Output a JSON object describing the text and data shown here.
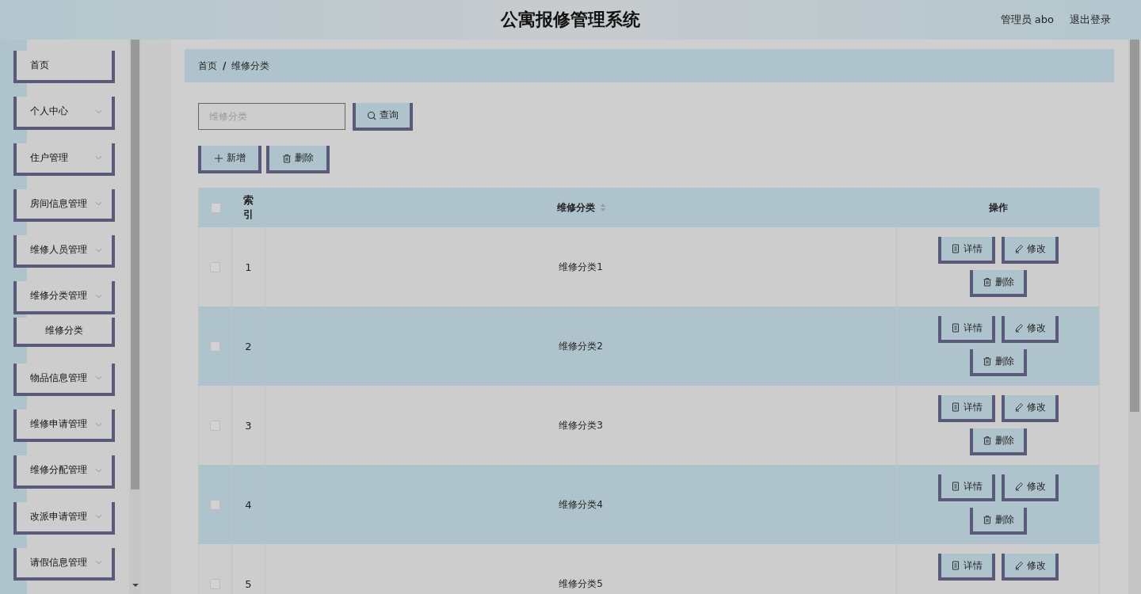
{
  "header": {
    "title": "公寓报修管理系统",
    "user": "管理员 abo",
    "logout": "退出登录"
  },
  "sidebar": {
    "items": [
      {
        "label": "首页",
        "kind": "link"
      },
      {
        "label": "个人中心",
        "kind": "group",
        "expanded": false
      },
      {
        "label": "住户管理",
        "kind": "group",
        "expanded": false
      },
      {
        "label": "房间信息管理",
        "kind": "group",
        "expanded": false
      },
      {
        "label": "维修人员管理",
        "kind": "group",
        "expanded": false
      },
      {
        "label": "维修分类管理",
        "kind": "group",
        "expanded": true,
        "children": [
          {
            "label": "维修分类"
          }
        ]
      },
      {
        "label": "物品信息管理",
        "kind": "group",
        "expanded": false
      },
      {
        "label": "维修申请管理",
        "kind": "group",
        "expanded": false
      },
      {
        "label": "维修分配管理",
        "kind": "group",
        "expanded": false
      },
      {
        "label": "改派申请管理",
        "kind": "group",
        "expanded": false
      },
      {
        "label": "请假信息管理",
        "kind": "group",
        "expanded": false
      }
    ]
  },
  "breadcrumb": [
    "首页",
    "/",
    "维修分类"
  ],
  "search": {
    "placeholder": "维修分类",
    "button": "查询"
  },
  "toolbar": {
    "add": "新增",
    "delete": "删除"
  },
  "table": {
    "header_checked": false,
    "columns": [
      "索引",
      "维修分类",
      "操作"
    ],
    "rows": [
      {
        "index": "1",
        "name": "维修分类1",
        "checked": false,
        "actions": [
          "详情",
          "修改",
          "删除"
        ]
      },
      {
        "index": "2",
        "name": "维修分类2",
        "checked": false,
        "actions": [
          "详情",
          "修改",
          "删除"
        ]
      },
      {
        "index": "3",
        "name": "维修分类3",
        "checked": false,
        "actions": [
          "详情",
          "修改",
          "删除"
        ]
      },
      {
        "index": "4",
        "name": "维修分类4",
        "checked": false,
        "actions": [
          "详情",
          "修改",
          "删除"
        ]
      },
      {
        "index": "5",
        "name": "维修分类5",
        "checked": false,
        "actions": [
          "详情",
          "修改"
        ]
      }
    ]
  }
}
